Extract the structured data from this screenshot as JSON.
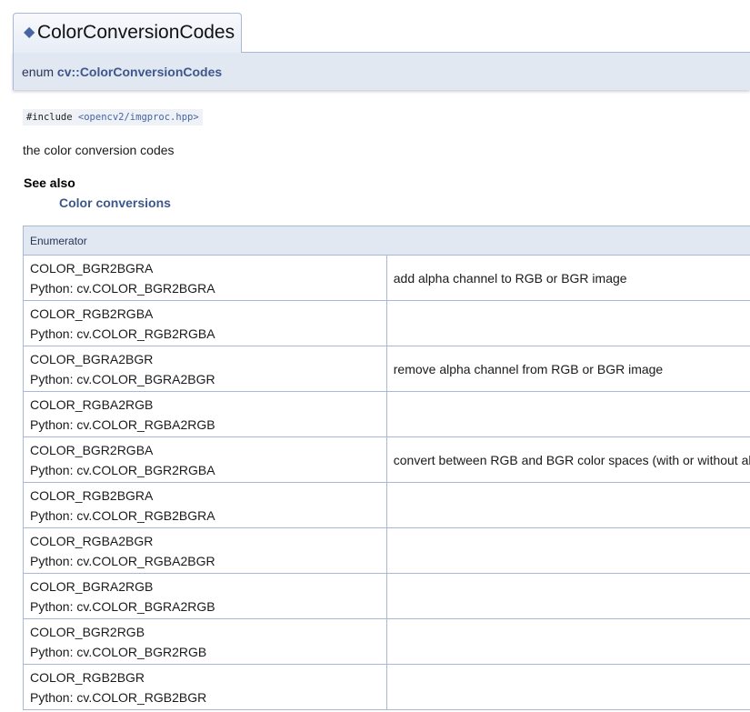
{
  "tab": {
    "icon": "diamond-icon",
    "title": "ColorConversionCodes"
  },
  "header": {
    "enum_keyword": "enum",
    "enum_name": "cv::ColorConversionCodes"
  },
  "include": {
    "directive": "#include",
    "path": "<opencv2/imgproc.hpp>"
  },
  "description": "the color conversion codes",
  "see_also": {
    "title": "See also",
    "link": "Color conversions"
  },
  "table": {
    "header": "Enumerator",
    "rows": [
      {
        "name": "COLOR_BGR2BGRA",
        "python": "Python: cv.COLOR_BGR2BGRA",
        "description": "add alpha channel to RGB or BGR image"
      },
      {
        "name": "COLOR_RGB2RGBA",
        "python": "Python: cv.COLOR_RGB2RGBA",
        "description": ""
      },
      {
        "name": "COLOR_BGRA2BGR",
        "python": "Python: cv.COLOR_BGRA2BGR",
        "description": "remove alpha channel from RGB or BGR image"
      },
      {
        "name": "COLOR_RGBA2RGB",
        "python": "Python: cv.COLOR_RGBA2RGB",
        "description": ""
      },
      {
        "name": "COLOR_BGR2RGBA",
        "python": "Python: cv.COLOR_BGR2RGBA",
        "description": "convert between RGB and BGR color spaces (with or without alpha channel)"
      },
      {
        "name": "COLOR_RGB2BGRA",
        "python": "Python: cv.COLOR_RGB2BGRA",
        "description": ""
      },
      {
        "name": "COLOR_RGBA2BGR",
        "python": "Python: cv.COLOR_RGBA2BGR",
        "description": ""
      },
      {
        "name": "COLOR_BGRA2RGB",
        "python": "Python: cv.COLOR_BGRA2RGB",
        "description": ""
      },
      {
        "name": "COLOR_BGR2RGB",
        "python": "Python: cv.COLOR_BGR2RGB",
        "description": ""
      },
      {
        "name": "COLOR_RGB2BGR",
        "python": "Python: cv.COLOR_RGB2BGR",
        "description": ""
      }
    ]
  },
  "colors": {
    "link": "#3d578c",
    "header_bg": "#e2e8f2",
    "border": "#a8b8d9",
    "include_bg": "#eef1f6"
  }
}
